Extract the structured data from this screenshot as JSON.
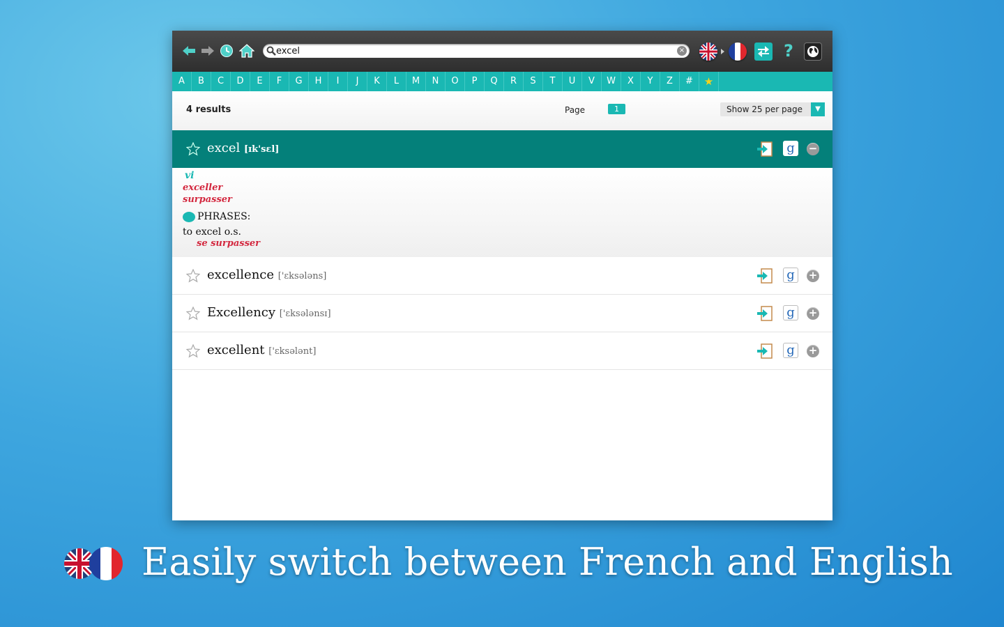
{
  "toolbar": {
    "search_value": "excel",
    "clear_symbol": "×",
    "help_symbol": "?",
    "icons": [
      "back-arrow-icon",
      "forward-arrow-icon",
      "history-icon",
      "home-icon",
      "search-icon",
      "uk-flag-icon",
      "france-flag-icon",
      "swap-language-icon",
      "help-icon",
      "globe-icon"
    ]
  },
  "alphabet": [
    "A",
    "B",
    "C",
    "D",
    "E",
    "F",
    "G",
    "H",
    "I",
    "J",
    "K",
    "L",
    "M",
    "N",
    "O",
    "P",
    "Q",
    "R",
    "S",
    "T",
    "U",
    "V",
    "W",
    "X",
    "Y",
    "Z",
    "#"
  ],
  "favorites_symbol": "★",
  "results": {
    "count_label": "4 results",
    "page_label": "Page",
    "current_page": "1",
    "per_page_label": "Show 25 per page",
    "dropdown_symbol": "▼"
  },
  "entries": [
    {
      "word": "excel",
      "pron": "[ɪk'sɛl]",
      "expanded": true
    },
    {
      "word": "excellence",
      "pron": "['ɛksələns]",
      "expanded": false
    },
    {
      "word": "Excellency",
      "pron": "['ɛksələnsɪ]",
      "expanded": false
    },
    {
      "word": "excellent",
      "pron": "['ɛksələnt]",
      "expanded": false
    }
  ],
  "definition": {
    "pos": "vi",
    "translations": [
      "exceller",
      "surpasser"
    ],
    "phrases_label": "PHRASES:",
    "example": "to excel o.s.",
    "example_translation": "se surpasser"
  },
  "actions": {
    "google_label": "g",
    "collapse_symbol": "−",
    "expand_symbol": "+"
  },
  "promo": {
    "text": "Easily switch between French and English"
  },
  "colors": {
    "teal": "#1ab8b3",
    "dark_teal": "#04807a",
    "red": "#d3273e",
    "toolbar": "#3a3a3a"
  }
}
